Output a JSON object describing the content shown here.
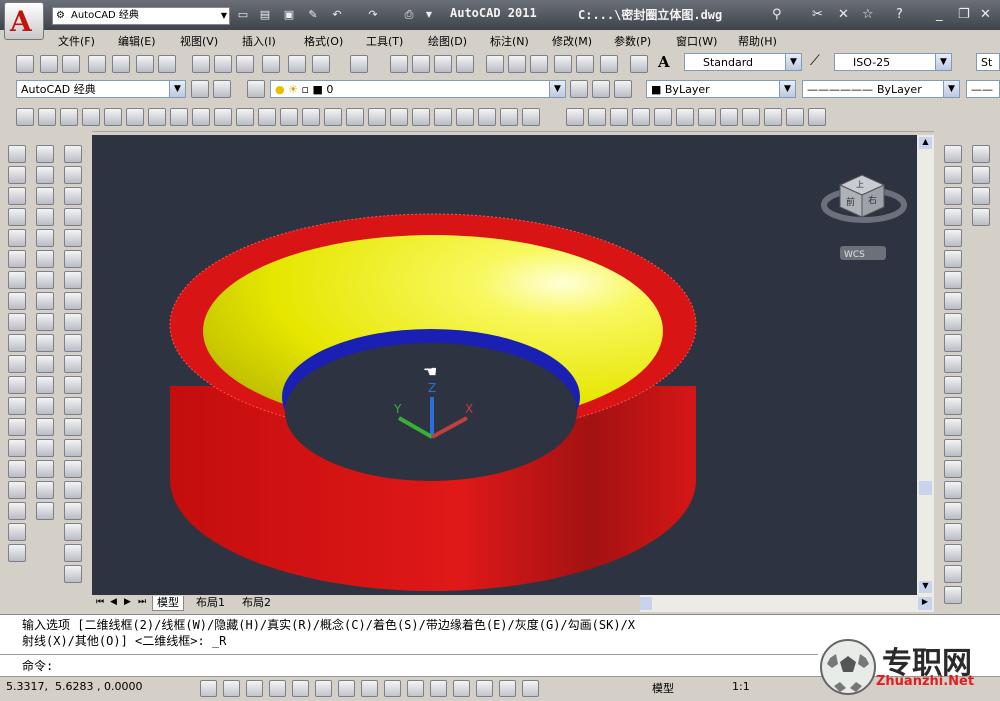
{
  "title_bar": {
    "app_title": "AutoCAD 2011",
    "file_title": "C:...\\密封圈立体图.dwg",
    "workspace": "AutoCAD 经典"
  },
  "menu": [
    "文件(F)",
    "编辑(E)",
    "视图(V)",
    "插入(I)",
    "格式(O)",
    "工具(T)",
    "绘图(D)",
    "标注(N)",
    "修改(M)",
    "参数(P)",
    "窗口(W)",
    "帮助(H)"
  ],
  "toolbar2": {
    "text_style": "Standard",
    "dim_style": "ISO-25",
    "table_style_prefix": "St"
  },
  "toolbar3": {
    "workspace": "AutoCAD 经典",
    "layer": "0",
    "color": "ByLayer",
    "linetype": "ByLayer"
  },
  "viewcube": {
    "face_top": "上",
    "face_front": "前",
    "face_right": "右",
    "wcs": "WCS"
  },
  "ucs": {
    "x": "X",
    "y": "Y",
    "z": "Z"
  },
  "tabs": [
    "模型",
    "布局1",
    "布局2"
  ],
  "command": {
    "line1": "输入选项 [二维线框(2)/线框(W)/隐藏(H)/真实(R)/概念(C)/着色(S)/带边缘着色(E)/灰度(G)/勾画(SK)/X",
    "line2": "射线(X)/其他(O)] <二维线框>: _R",
    "prompt": "命令:"
  },
  "status": {
    "coords": "5.3317,  5.6283 , 0.0000",
    "model": "模型",
    "scale": "1:1"
  },
  "watermark": {
    "cn": "专职网",
    "en": "Zhuanzhi.Net"
  },
  "colors": {
    "viewport_bg": "#2d3340",
    "ring_outer": "#d81414",
    "ring_inner": "#f0f000",
    "ring_bottom": "#1a20b4"
  }
}
